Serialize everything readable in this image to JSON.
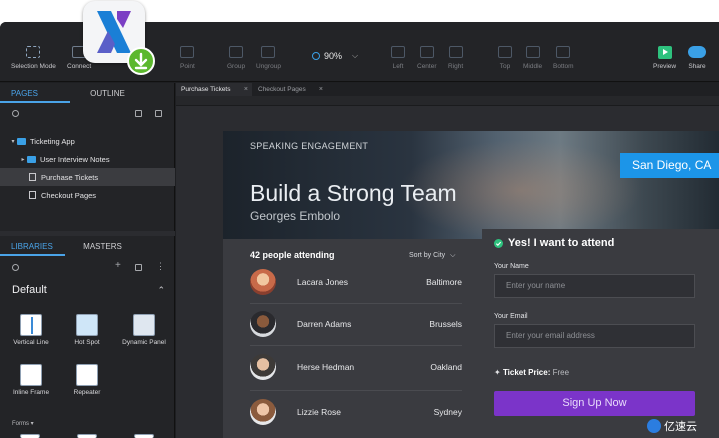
{
  "toolbar": {
    "selection_mode": "Selection Mode",
    "connect": "Connect",
    "point": "Point",
    "group": "Group",
    "ungroup": "Ungroup",
    "zoom": "90%",
    "left": "Left",
    "center": "Center",
    "right": "Right",
    "top": "Top",
    "middle": "Middle",
    "bottom": "Bottom",
    "preview": "Preview",
    "share": "Share"
  },
  "pages_panel": {
    "tab_pages": "PAGES",
    "tab_outline": "OUTLINE",
    "items": [
      {
        "label": "Ticketing App"
      },
      {
        "label": "User Interview Notes"
      },
      {
        "label": "Purchase Tickets"
      },
      {
        "label": "Checkout Pages"
      }
    ]
  },
  "libraries_panel": {
    "tab_libraries": "LIBRARIES",
    "tab_masters": "MASTERS",
    "library": "Default",
    "widgets": [
      {
        "label": "Vertical Line"
      },
      {
        "label": "Hot Spot"
      },
      {
        "label": "Dynamic Panel"
      },
      {
        "label": "Inline Frame"
      },
      {
        "label": "Repeater"
      }
    ],
    "forms_label": "Forms ▾"
  },
  "canvas_tabs": [
    {
      "label": "Purchase Tickets"
    },
    {
      "label": "Checkout Pages"
    }
  ],
  "design": {
    "kicker": "SPEAKING ENGAGEMENT",
    "title": "Build a Strong Team",
    "speaker": "Georges Embolo",
    "city_badge": "San Diego, CA",
    "attending": "42 people attending",
    "sort": "Sort by City",
    "people": [
      {
        "name": "Lacara Jones",
        "city": "Baltimore"
      },
      {
        "name": "Darren Adams",
        "city": "Brussels"
      },
      {
        "name": "Herse Hedman",
        "city": "Oakland"
      },
      {
        "name": "Lizzie Rose",
        "city": "Sydney"
      }
    ],
    "form": {
      "title": "Yes! I want to attend",
      "name_label": "Your Name",
      "name_placeholder": "Enter your name",
      "email_label": "Your Email",
      "email_placeholder": "Enter your email address",
      "price_label": "Ticket Price:",
      "price_value": "Free",
      "button": "Sign Up Now"
    }
  },
  "watermark": "亿速云"
}
